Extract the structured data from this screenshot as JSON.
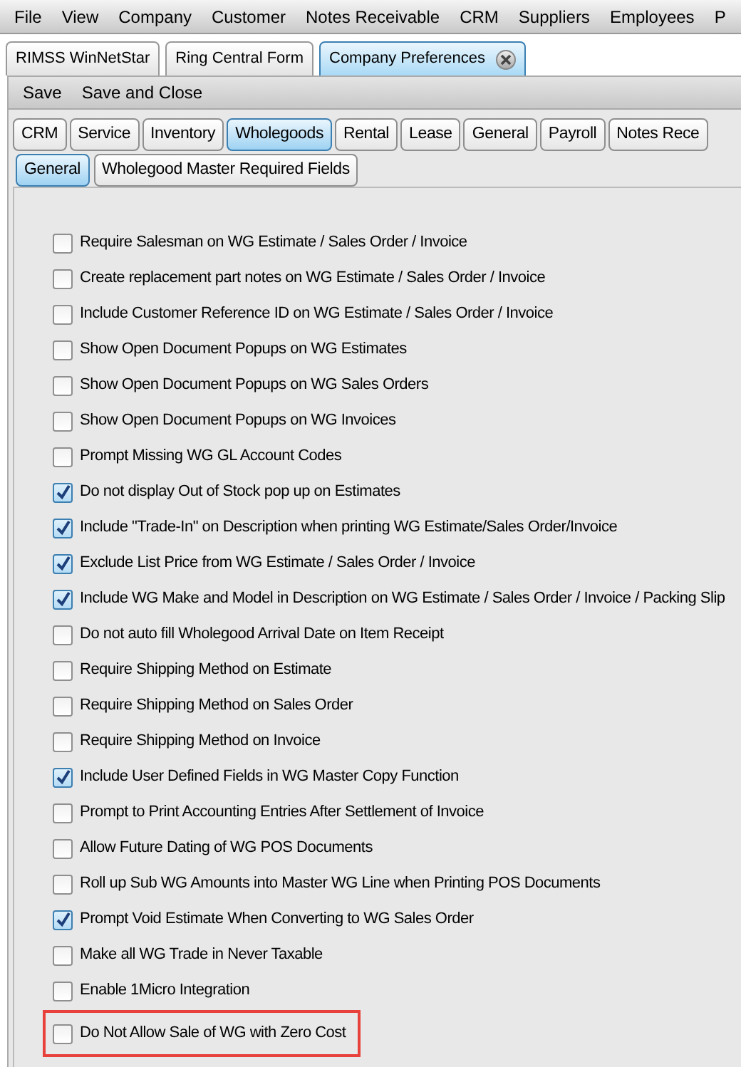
{
  "menu_bar": [
    "File",
    "View",
    "Company",
    "Customer",
    "Notes Receivable",
    "CRM",
    "Suppliers",
    "Employees",
    "P"
  ],
  "document_tabs": [
    {
      "label": "RIMSS WinNetStar",
      "selected": false,
      "closable": false
    },
    {
      "label": "Ring Central Form",
      "selected": false,
      "closable": false
    },
    {
      "label": "Company Preferences",
      "selected": true,
      "closable": true
    }
  ],
  "toolbar": [
    "Save",
    "Save and Close"
  ],
  "section_tabs": [
    {
      "label": "CRM",
      "selected": false
    },
    {
      "label": "Service",
      "selected": false
    },
    {
      "label": "Inventory",
      "selected": false
    },
    {
      "label": "Wholegoods",
      "selected": true
    },
    {
      "label": "Rental",
      "selected": false
    },
    {
      "label": "Lease",
      "selected": false
    },
    {
      "label": "General",
      "selected": false
    },
    {
      "label": "Payroll",
      "selected": false
    },
    {
      "label": "Notes Rece",
      "selected": false
    }
  ],
  "sub_tabs": [
    {
      "label": "General",
      "selected": true
    },
    {
      "label": "Wholegood Master Required Fields",
      "selected": false
    }
  ],
  "options": [
    {
      "label": "Require Salesman on WG Estimate / Sales Order / Invoice",
      "checked": false,
      "highlighted": false
    },
    {
      "label": "Create replacement part notes on WG Estimate / Sales Order / Invoice",
      "checked": false,
      "highlighted": false
    },
    {
      "label": "Include Customer Reference ID on WG Estimate / Sales Order / Invoice",
      "checked": false,
      "highlighted": false
    },
    {
      "label": "Show Open Document Popups on WG Estimates",
      "checked": false,
      "highlighted": false
    },
    {
      "label": "Show Open Document Popups on WG Sales Orders",
      "checked": false,
      "highlighted": false
    },
    {
      "label": "Show Open Document Popups on WG Invoices",
      "checked": false,
      "highlighted": false
    },
    {
      "label": "Prompt Missing WG GL Account Codes",
      "checked": false,
      "highlighted": false
    },
    {
      "label": "Do not display Out of Stock pop up on Estimates",
      "checked": true,
      "highlighted": false
    },
    {
      "label": "Include \"Trade-In\" on Description when printing WG Estimate/Sales Order/Invoice",
      "checked": true,
      "highlighted": false
    },
    {
      "label": "Exclude List Price from WG Estimate / Sales Order / Invoice",
      "checked": true,
      "highlighted": false
    },
    {
      "label": "Include WG Make and Model in Description on WG Estimate / Sales Order / Invoice / Packing Slip",
      "checked": true,
      "highlighted": false
    },
    {
      "label": "Do not auto fill Wholegood Arrival Date on Item Receipt",
      "checked": false,
      "highlighted": false
    },
    {
      "label": "Require Shipping Method on Estimate",
      "checked": false,
      "highlighted": false
    },
    {
      "label": "Require Shipping Method on Sales Order",
      "checked": false,
      "highlighted": false
    },
    {
      "label": "Require Shipping Method on Invoice",
      "checked": false,
      "highlighted": false
    },
    {
      "label": "Include User Defined Fields in WG Master Copy Function",
      "checked": true,
      "highlighted": false
    },
    {
      "label": "Prompt to Print Accounting Entries After Settlement of Invoice",
      "checked": false,
      "highlighted": false
    },
    {
      "label": "Allow Future Dating of WG POS Documents",
      "checked": false,
      "highlighted": false
    },
    {
      "label": "Roll up Sub WG Amounts into Master WG Line when Printing POS Documents",
      "checked": false,
      "highlighted": false
    },
    {
      "label": "Prompt Void Estimate When Converting to WG Sales Order",
      "checked": true,
      "highlighted": false
    },
    {
      "label": "Make all WG Trade in Never Taxable",
      "checked": false,
      "highlighted": false
    },
    {
      "label": "Enable 1Micro Integration",
      "checked": false,
      "highlighted": false
    },
    {
      "label": "Do Not Allow Sale of WG with Zero Cost",
      "checked": false,
      "highlighted": true
    }
  ]
}
